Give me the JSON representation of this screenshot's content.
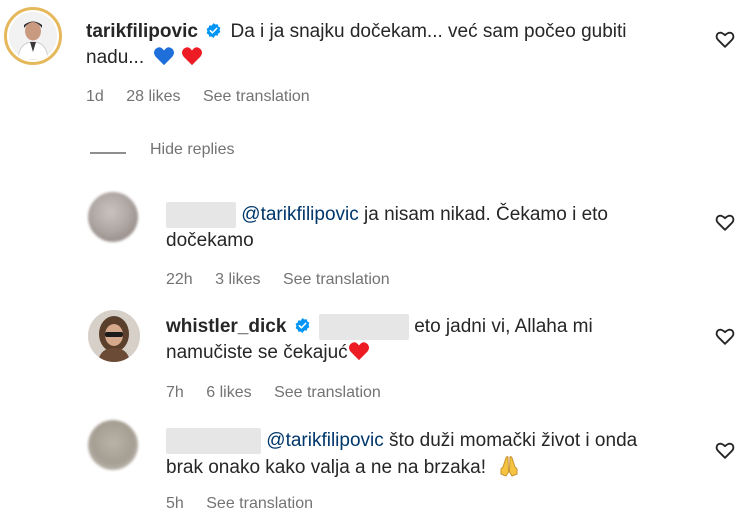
{
  "comments": [
    {
      "username": "tarikfilipovic",
      "verified": true,
      "text_line1": "Da i ja snajku dočekam... već sam počeo gubiti",
      "text_line2": "nadu...",
      "time": "1d",
      "likes": "28 likes",
      "translate": "See translation",
      "emoji": [
        "blue-heart",
        "red-heart"
      ]
    }
  ],
  "hide_replies": "Hide replies",
  "replies": [
    {
      "mention": "@tarikfilipovic",
      "text_line1": " ja nisam nikad. Čekamo i eto",
      "text_line2": "dočekamo",
      "time": "22h",
      "likes": "3 likes",
      "translate": "See translation"
    },
    {
      "username": "whistler_dick",
      "verified": true,
      "text_line1": "eto jadni vi, Allaha mi",
      "text_line2": "namučiste se čekajuć",
      "time": "7h",
      "likes": "6 likes",
      "translate": "See translation"
    },
    {
      "mention": "@tarikfilipovic",
      "text_line1": " što duži momački život i onda",
      "text_line2": "brak onako kako valja a ne na brzaka!",
      "time": "5h",
      "translate": "See translation"
    }
  ],
  "colors": {
    "verified": "#0095f6",
    "meta": "#737373",
    "heart_red": "#ed1c24",
    "heart_blue": "#1e6fd9"
  }
}
